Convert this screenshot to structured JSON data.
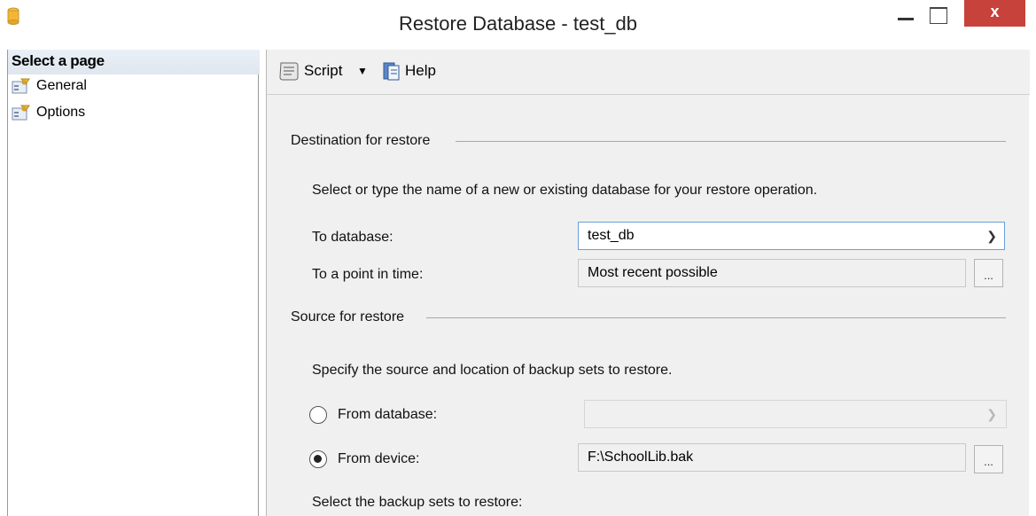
{
  "window": {
    "title": "Restore Database - test_db",
    "close_glyph": "x"
  },
  "left_panel": {
    "header": "Select a page",
    "items": [
      {
        "label": "General",
        "icon": "page-icon"
      },
      {
        "label": "Options",
        "icon": "page-icon"
      }
    ]
  },
  "toolbar": {
    "script_label": "Script",
    "dropdown_glyph": "▼",
    "help_label": "Help"
  },
  "destination": {
    "group_label": "Destination for restore",
    "description": "Select or type the name of a new or existing database for your restore operation.",
    "to_database_label": "To database:",
    "to_database_value": "test_db",
    "point_in_time_label": "To a point in time:",
    "point_in_time_value": "Most recent possible",
    "ellipsis": "..."
  },
  "source": {
    "group_label": "Source for restore",
    "description": "Specify the source and location of backup sets to restore.",
    "from_database_label": "From database:",
    "from_device_label": "From device:",
    "from_device_value": "F:\\SchoolLib.bak",
    "selected_option": "From device",
    "ellipsis": "...",
    "backup_sets_label": "Select the backup sets to restore:"
  },
  "colors": {
    "close_button": "#c7423a",
    "focus_border": "#6a9fd8",
    "panel_background": "#f0f0f0"
  }
}
